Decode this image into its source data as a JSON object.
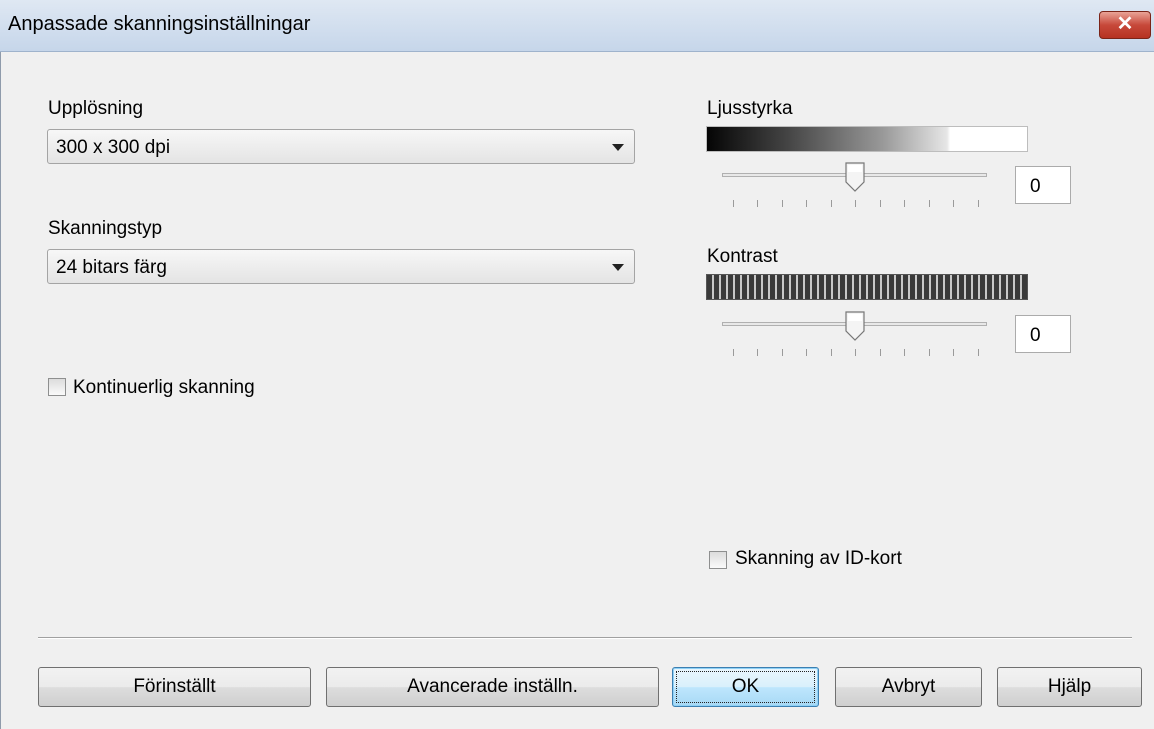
{
  "window": {
    "title": "Anpassade skanningsinställningar",
    "close_label": "✕"
  },
  "resolution": {
    "label": "Upplösning",
    "value": "300 x 300 dpi"
  },
  "scan_type": {
    "label": "Skanningstyp",
    "value": "24 bitars färg"
  },
  "continuous_scan": {
    "label": "Kontinuerlig skanning",
    "checked": false
  },
  "brightness": {
    "label": "Ljusstyrka",
    "value": "0",
    "slider_fraction": 0.5
  },
  "contrast": {
    "label": "Kontrast",
    "value": "0",
    "slider_fraction": 0.5
  },
  "id_card_scan": {
    "label": "Skanning av ID-kort",
    "checked": false
  },
  "buttons": {
    "preset": "Förinställt",
    "advanced": "Avancerade inställn.",
    "ok": "OK",
    "cancel": "Avbryt",
    "help": "Hjälp"
  },
  "colors": {
    "titlebar": "#c6d6ea",
    "close": "#c7493a",
    "dialog_bg": "#f0f0f0",
    "default_button_border": "#3c7fb1"
  }
}
